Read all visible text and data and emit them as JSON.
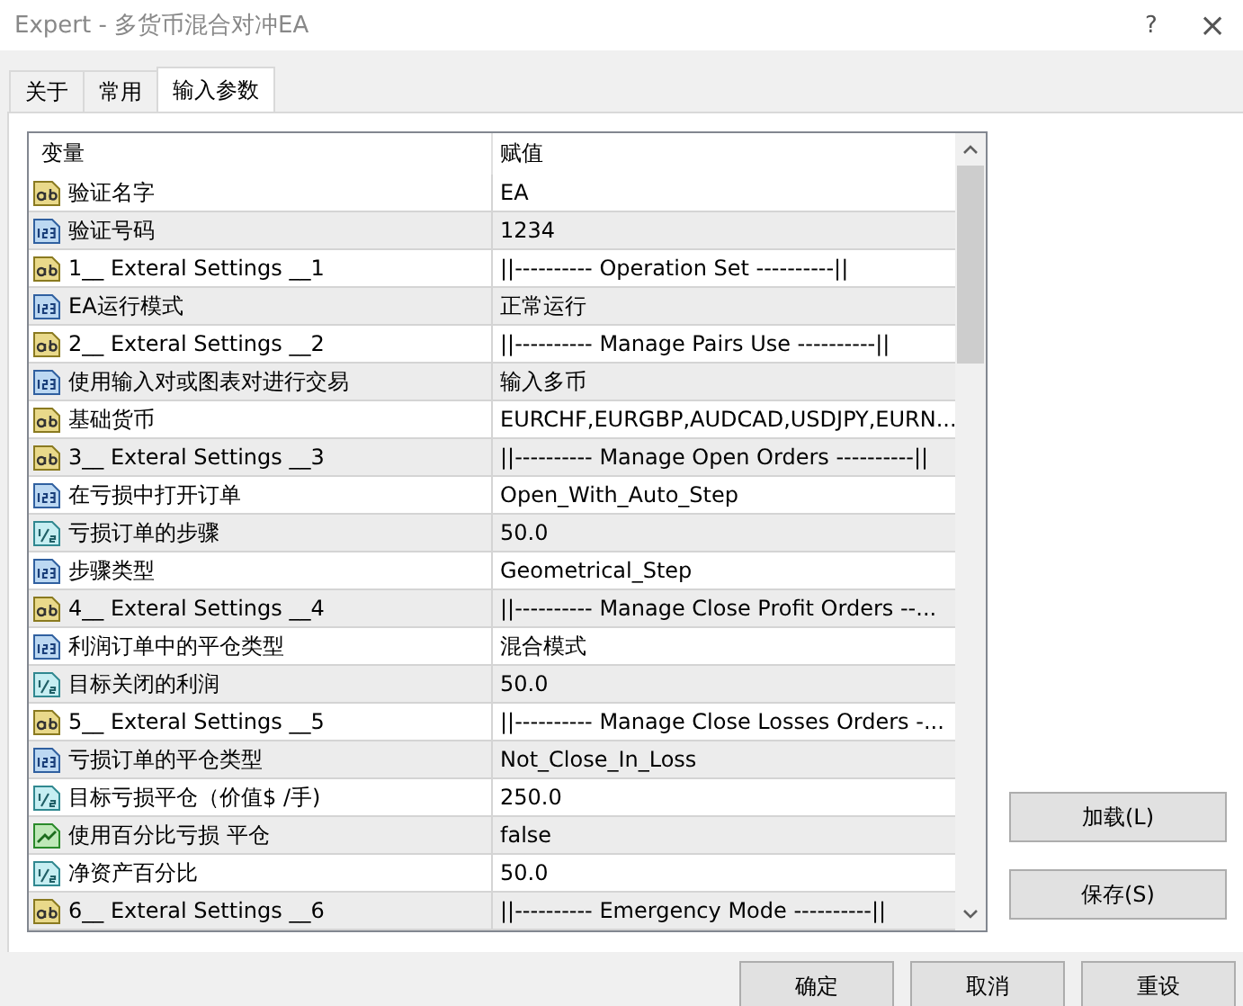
{
  "window": {
    "title": "Expert - 多货币混合对冲EA",
    "help": "?",
    "close": "×"
  },
  "tabs": [
    {
      "label": "关于",
      "selected": false
    },
    {
      "label": "常用",
      "selected": false
    },
    {
      "label": "输入参数",
      "selected": true
    }
  ],
  "table": {
    "columns": [
      "变量",
      "赋值"
    ],
    "rows": [
      {
        "kind": "text",
        "name": "验证名字",
        "value": "EA"
      },
      {
        "kind": "int",
        "name": "验证号码",
        "value": "1234"
      },
      {
        "kind": "text",
        "name": "1__ Exteral Settings __1",
        "value": "||---------- Operation Set ----------||"
      },
      {
        "kind": "int",
        "name": "EA运行模式",
        "value": "正常运行"
      },
      {
        "kind": "text",
        "name": "2__ Exteral Settings __2",
        "value": "||---------- Manage Pairs Use ----------||"
      },
      {
        "kind": "int",
        "name": "使用输入对或图表对进行交易",
        "value": "输入多币"
      },
      {
        "kind": "text",
        "name": "基础货币",
        "value": "EURCHF,EURGBP,AUDCAD,USDJPY,EURN..."
      },
      {
        "kind": "text",
        "name": "3__ Exteral Settings __3",
        "value": "||---------- Manage Open Orders ----------||"
      },
      {
        "kind": "int",
        "name": "在亏损中打开订单",
        "value": "Open_With_Auto_Step"
      },
      {
        "kind": "double",
        "name": "亏损订单的步骤",
        "value": "50.0"
      },
      {
        "kind": "int",
        "name": "步骤类型",
        "value": "Geometrical_Step"
      },
      {
        "kind": "text",
        "name": "4__ Exteral Settings __4",
        "value": "||---------- Manage Close Profit Orders --..."
      },
      {
        "kind": "int",
        "name": "利润订单中的平仓类型",
        "value": "混合模式"
      },
      {
        "kind": "double",
        "name": "目标关闭的利润",
        "value": "50.0"
      },
      {
        "kind": "text",
        "name": "5__ Exteral Settings __5",
        "value": "||---------- Manage Close Losses Orders -..."
      },
      {
        "kind": "int",
        "name": "亏损订单的平仓类型",
        "value": "Not_Close_In_Loss"
      },
      {
        "kind": "double",
        "name": "目标亏损平仓（价值$ /手)",
        "value": "250.0"
      },
      {
        "kind": "bool",
        "name": "使用百分比亏损 平仓",
        "value": "false"
      },
      {
        "kind": "double",
        "name": "净资产百分比",
        "value": "50.0"
      },
      {
        "kind": "text",
        "name": "6__ Exteral Settings __6",
        "value": "||---------- Emergency Mode ----------||"
      }
    ]
  },
  "side_buttons": [
    "加载(L)",
    "保存(S)"
  ],
  "buttons": [
    "确定",
    "取消",
    "重设"
  ]
}
